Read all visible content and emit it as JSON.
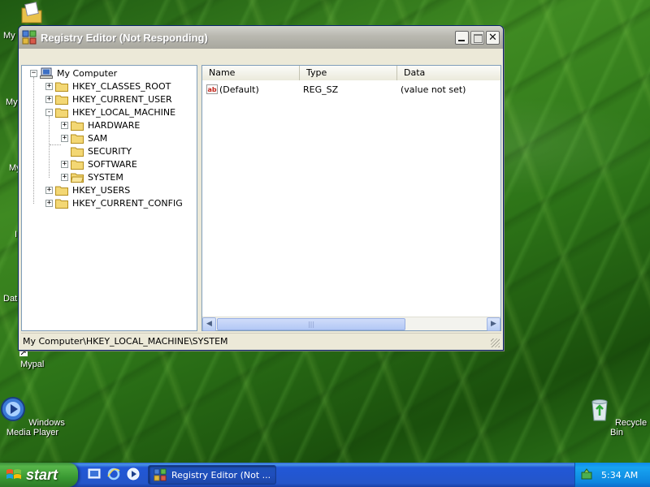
{
  "window": {
    "title": "Registry Editor (Not Responding)",
    "status_path": "My Computer\\HKEY_LOCAL_MACHINE\\SYSTEM"
  },
  "tree": {
    "root": "My Computer",
    "items": [
      {
        "label": "HKEY_CLASSES_ROOT",
        "expander": "+"
      },
      {
        "label": "HKEY_CURRENT_USER",
        "expander": "+"
      },
      {
        "label": "HKEY_LOCAL_MACHINE",
        "expander": "-"
      },
      {
        "label": "HARDWARE",
        "expander": "+"
      },
      {
        "label": "SAM",
        "expander": "+"
      },
      {
        "label": "SECURITY",
        "expander": ""
      },
      {
        "label": "SOFTWARE",
        "expander": "+"
      },
      {
        "label": "SYSTEM",
        "expander": "+"
      },
      {
        "label": "HKEY_USERS",
        "expander": "+"
      },
      {
        "label": "HKEY_CURRENT_CONFIG",
        "expander": "+"
      }
    ]
  },
  "list": {
    "columns": [
      "Name",
      "Type",
      "Data"
    ],
    "rows": [
      {
        "name": "(Default)",
        "type": "REG_SZ",
        "data": "(value not set)"
      }
    ]
  },
  "desktop": {
    "edge_labels": [
      "My",
      "My",
      "My",
      "I",
      "Dat"
    ],
    "icons": [
      {
        "label": "Mypal"
      },
      {
        "label": "Windows Media Player"
      },
      {
        "label": "Recycle Bin"
      }
    ]
  },
  "taskbar": {
    "start_label": "start",
    "task_label": "Registry Editor (Not ...",
    "clock": "5:34 AM"
  },
  "icons": {
    "window_icon": "regedit-icon",
    "computer": "computer-icon",
    "folder": "folder-icon",
    "string_value": "ab-string-value-icon"
  }
}
